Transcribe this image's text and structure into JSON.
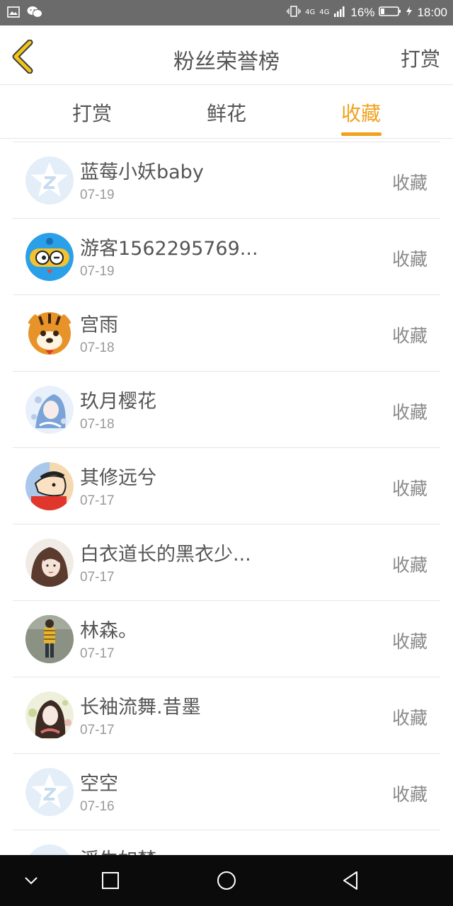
{
  "status_bar": {
    "network": "4G",
    "network2": "4G",
    "battery_percent": "16%",
    "time": "18:00",
    "icons": [
      "image-icon",
      "wechat-icon",
      "vibrate-icon",
      "signal-icon",
      "battery-icon",
      "charging-icon"
    ]
  },
  "header": {
    "title": "粉丝荣誉榜",
    "action_label": "打赏"
  },
  "tabs": [
    {
      "label": "打赏",
      "active": false
    },
    {
      "label": "鲜花",
      "active": false
    },
    {
      "label": "收藏",
      "active": true
    }
  ],
  "colors": {
    "accent": "#f0a21e",
    "text": "#555555",
    "muted": "#9a9a9a",
    "status_bar": "#6b6b6b",
    "nav_bar": "#0b0b0b"
  },
  "list": [
    {
      "name": "蓝莓小妖baby",
      "date": "07-19",
      "action": "收藏",
      "avatar": "default-avatar"
    },
    {
      "name": "游客1562295769...",
      "date": "07-19",
      "action": "收藏",
      "avatar": "robot-avatar"
    },
    {
      "name": "宫雨",
      "date": "07-18",
      "action": "收藏",
      "avatar": "tiger-avatar"
    },
    {
      "name": "玖月樱花",
      "date": "07-18",
      "action": "收藏",
      "avatar": "anime-girl-avatar"
    },
    {
      "name": "其修远兮",
      "date": "07-17",
      "action": "收藏",
      "avatar": "cartoon-avatar"
    },
    {
      "name": "白衣道长的黑衣少...",
      "date": "07-17",
      "action": "收藏",
      "avatar": "portrait-avatar"
    },
    {
      "name": "林森。",
      "date": "07-17",
      "action": "收藏",
      "avatar": "photo-avatar"
    },
    {
      "name": "长袖流舞.昔墨",
      "date": "07-17",
      "action": "收藏",
      "avatar": "illustration-avatar"
    },
    {
      "name": "空空",
      "date": "07-16",
      "action": "收藏",
      "avatar": "default-avatar"
    }
  ],
  "partial_item_name": "浮生如梦"
}
